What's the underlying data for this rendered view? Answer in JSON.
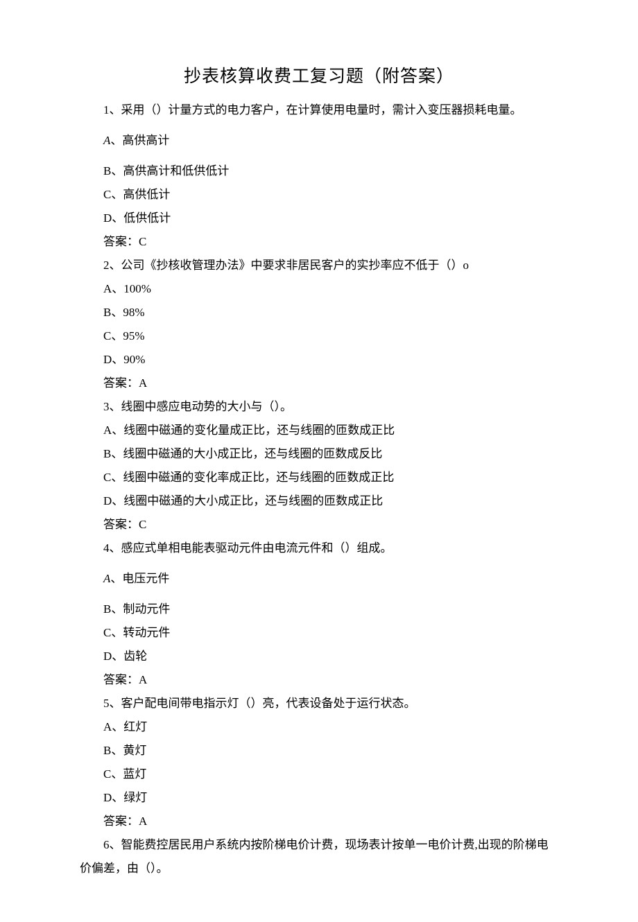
{
  "title": "抄表核算收费工复习题（附答案）",
  "q1": {
    "stem": "1、采用（）计量方式的电力客户，在计算使用电量时，需计入变压器损耗电量。",
    "a_prefix": "A",
    "a_text": "、高供高计",
    "b": "B、高供高计和低供低计",
    "c": "C、高供低计",
    "d": "D、低供低计",
    "ans": "答案：C"
  },
  "q2": {
    "stem": "2、公司《抄核收管理办法》中要求非居民客户的实抄率应不低于（）o",
    "a": "A、100%",
    "b": "B、98%",
    "c": "C、95%",
    "d": "D、90%",
    "ans": "答案：A"
  },
  "q3": {
    "stem": "3、线圈中感应电动势的大小与（）。",
    "a": "A、线圈中磁通的变化量成正比，还与线圈的匝数成正比",
    "b": "B、线圈中磁通的大小成正比，还与线圈的匝数成反比",
    "c": "C、线圈中磁通的变化率成正比，还与线圈的匝数成正比",
    "d": "D、线圈中磁通的大小成正比，还与线圈的匝数成正比",
    "ans": "答案：C"
  },
  "q4": {
    "stem": "4、感应式单相电能表驱动元件由电流元件和（）组成。",
    "a_prefix": "A",
    "a_text": "、电压元件",
    "b": "B、制动元件",
    "c": "C、转动元件",
    "d": "D、齿轮",
    "ans": "答案：A"
  },
  "q5": {
    "stem": "5、客户配电间带电指示灯（）亮，代表设备处于运行状态。",
    "a": "A、红灯",
    "b": "B、黄灯",
    "c": "C、蓝灯",
    "d": "D、绿灯",
    "ans": "答案：A"
  },
  "q6": {
    "stem": "6、智能费控居民用户系统内按阶梯电价计费，现场表计按单一电价计费,出现的阶梯电价偏差，由（）。"
  }
}
